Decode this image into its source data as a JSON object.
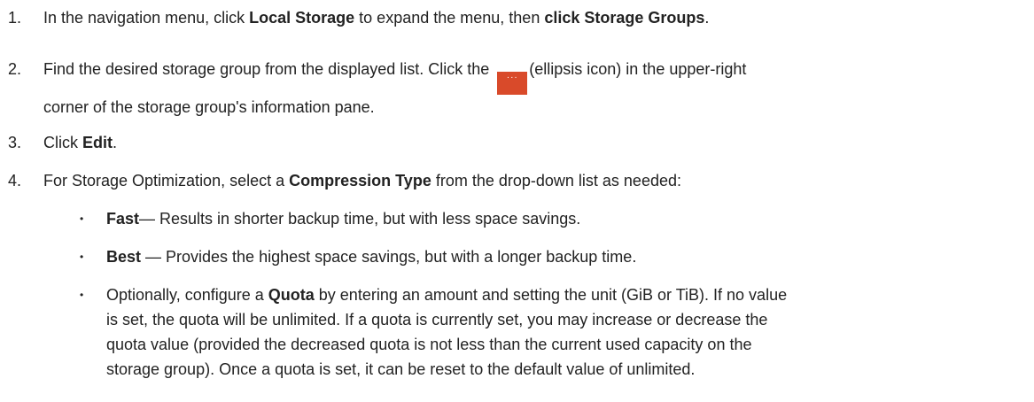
{
  "steps": [
    {
      "number": "1.",
      "parts": [
        "In the navigation menu, click ",
        "Local Storage",
        " to expand the menu, then ",
        "click Storage Groups",
        "."
      ]
    },
    {
      "number": "2.",
      "line1_a": "Find the desired storage group from the displayed list. Click the ",
      "icon_glyph": "···",
      "line1_b": "(ellipsis icon) in the upper-right",
      "line2": "corner of the storage group's information pane."
    },
    {
      "number": "3.",
      "parts": [
        "Click ",
        "Edit",
        "."
      ]
    },
    {
      "number": "4.",
      "parts": [
        "For Storage Optimization, select a ",
        "Compression Type",
        " from the drop-down list as needed:"
      ]
    }
  ],
  "bullets": [
    {
      "mark": "•",
      "bold": "Fast",
      "text": "— Results in shorter backup time, but with less space savings."
    },
    {
      "mark": "•",
      "bold": "Best",
      "text": " — Provides the highest space savings, but with a longer backup time."
    },
    {
      "mark": "•",
      "pre": "Optionally, configure a ",
      "bold": "Quota",
      "lines": [
        " by entering an amount and setting the unit (GiB or TiB). If no value",
        "is set, the quota will be unlimited. If a quota is currently set, you may increase or decrease the",
        "quota value (provided the decreased quota is not less than the current used capacity on the",
        "storage group). Once a quota is set, it can be reset to the default value of unlimited."
      ]
    }
  ],
  "colors": {
    "icon_background": "#d94a2a",
    "text": "#222222"
  },
  "icons": {
    "ellipsis": "ellipsis-icon"
  }
}
